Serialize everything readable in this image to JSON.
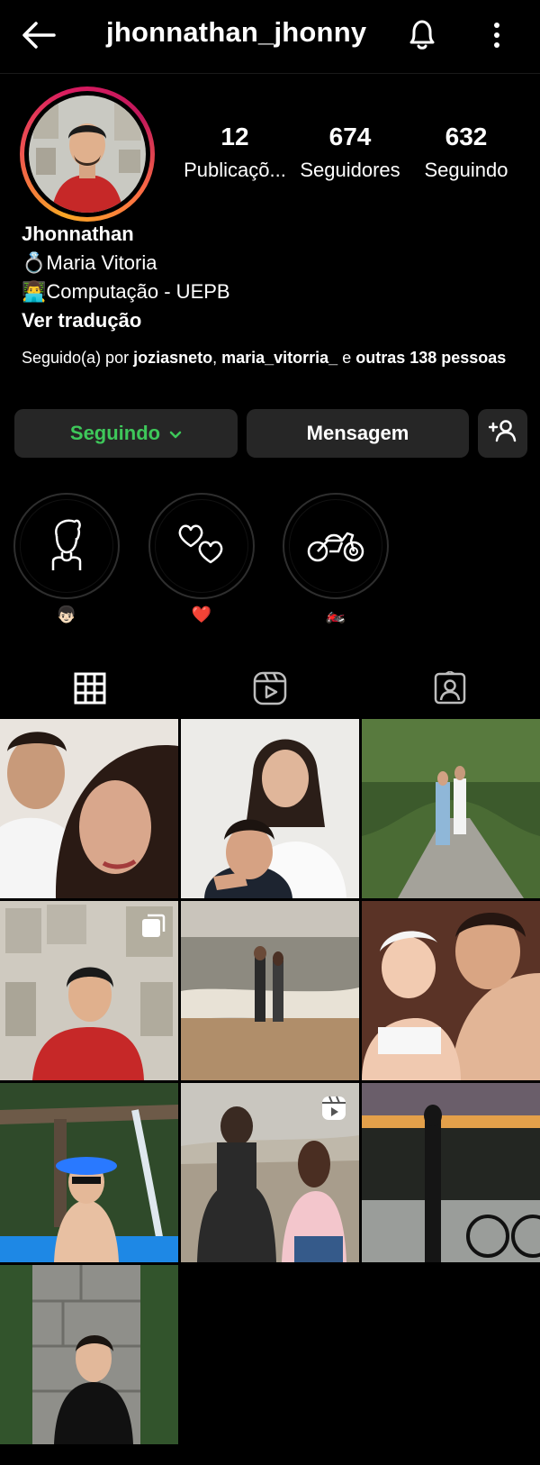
{
  "header": {
    "username": "jhonnathan_jhonny",
    "back_icon": "arrow-left-icon",
    "bell_icon": "bell-icon",
    "more_icon": "more-vertical-icon"
  },
  "profile": {
    "stats": [
      {
        "value": "12",
        "label": "Publicaçõ..."
      },
      {
        "value": "674",
        "label": "Seguidores"
      },
      {
        "value": "632",
        "label": "Seguindo"
      }
    ],
    "name": "Jhonnathan",
    "bio_line_1": "💍Maria Vitoria",
    "bio_line_2": "👨‍💻Computação - UEPB",
    "translate": "Ver tradução",
    "followed_prefix": "Seguido(a) por ",
    "followed_user_1": "joziasneto",
    "followed_sep": ", ",
    "followed_user_2": "maria_vitorria_",
    "followed_and": " e ",
    "followed_others": "outras 138 pessoas"
  },
  "actions": {
    "following_label": "Seguindo",
    "message_label": "Mensagem"
  },
  "highlights": [
    {
      "label": "👦🏻",
      "icon": "boy-avatar-icon"
    },
    {
      "label": "❤️",
      "icon": "hearts-icon"
    },
    {
      "label": "🏍️",
      "icon": "motorcycle-icon"
    }
  ],
  "tabs": [
    {
      "icon": "grid-icon",
      "active": true
    },
    {
      "icon": "reels-icon",
      "active": false
    },
    {
      "icon": "tagged-icon",
      "active": false
    }
  ],
  "posts": [
    {
      "type": "photo"
    },
    {
      "type": "photo"
    },
    {
      "type": "photo"
    },
    {
      "type": "carousel"
    },
    {
      "type": "photo"
    },
    {
      "type": "photo"
    },
    {
      "type": "photo"
    },
    {
      "type": "reel"
    },
    {
      "type": "photo"
    },
    {
      "type": "photo"
    }
  ],
  "colors": {
    "background": "#000000",
    "button": "#262626",
    "following_green": "#3ec85a"
  }
}
